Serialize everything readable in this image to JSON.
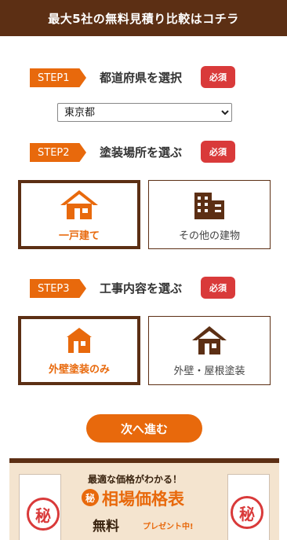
{
  "header": {
    "title": "最大5社の無料見積り比較はコチラ"
  },
  "step1": {
    "tag": "STEP1",
    "title": "都道府県を選択",
    "required": "必須",
    "select_value": "東京都"
  },
  "step2": {
    "tag": "STEP2",
    "title": "塗装場所を選ぶ",
    "required": "必須",
    "options": [
      {
        "label": "一戸建て"
      },
      {
        "label": "その他の建物"
      }
    ]
  },
  "step3": {
    "tag": "STEP3",
    "title": "工事内容を選ぶ",
    "required": "必須",
    "options": [
      {
        "label": "外壁塗装のみ"
      },
      {
        "label": "外壁・屋根塗装"
      }
    ]
  },
  "next_button": {
    "label": "次へ進む"
  },
  "banner": {
    "subtitle": "最適な価格がわかる！",
    "seal_char": "秘",
    "main": "相場価格表",
    "free": "無料",
    "gift": "プレゼント中!"
  },
  "colors": {
    "accent": "#e8690c",
    "brown": "#5c2f14",
    "required": "#d93a3a"
  }
}
